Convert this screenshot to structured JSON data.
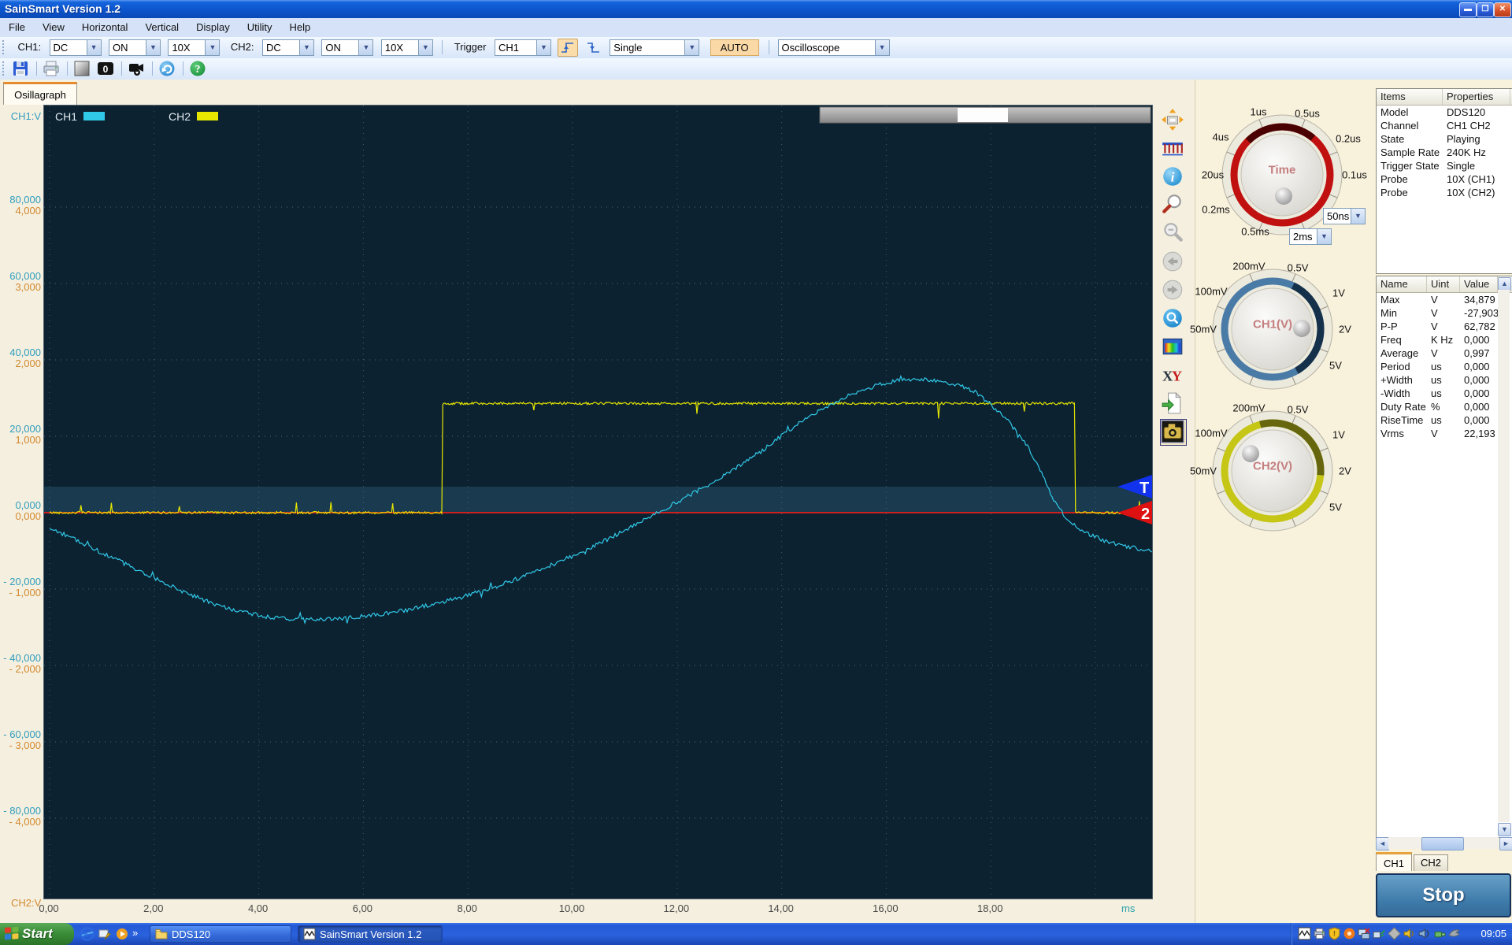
{
  "window": {
    "title": "SainSmart  Version 1.2",
    "minimize": "minimize",
    "maximize": "maximize",
    "close": "close"
  },
  "menu": {
    "items": [
      "File",
      "View",
      "Horizontal",
      "Vertical",
      "Display",
      "Utility",
      "Help"
    ]
  },
  "controls_bar": {
    "ch1_label": "CH1:",
    "ch1_coupling": "DC",
    "ch1_on": "ON",
    "ch1_probe": "10X",
    "ch2_label": "CH2:",
    "ch2_coupling": "DC",
    "ch2_on": "ON",
    "ch2_probe": "10X",
    "trigger_label": "Trigger",
    "trigger_source": "CH1",
    "trigger_mode": "Single",
    "auto_button": "AUTO",
    "instrument": "Oscilloscope"
  },
  "icon_bar": [
    "save",
    "print",
    "background",
    "counter",
    "record",
    "refresh",
    "help"
  ],
  "counter_value": "0",
  "tab_label": "Osillagraph",
  "scope": {
    "legend": [
      {
        "label": "CH1",
        "color": "#31c9e8"
      },
      {
        "label": "CH2",
        "color": "#e6e600"
      }
    ],
    "y_top": "CH1:V",
    "y_bottom": "CH2:V",
    "y_ticks": [
      {
        "value": 80000,
        "ch1": "80,000",
        "ch2": "4,000"
      },
      {
        "value": 60000,
        "ch1": "60,000",
        "ch2": "3,000"
      },
      {
        "value": 40000,
        "ch1": "40,000",
        "ch2": "2,000"
      },
      {
        "value": 20000,
        "ch1": "20,000",
        "ch2": "1,000"
      },
      {
        "value": 0,
        "ch1": "0,000",
        "ch2": "0,000"
      },
      {
        "value": -20000,
        "ch1": "- 20,000",
        "ch2": "- 1,000"
      },
      {
        "value": -40000,
        "ch1": "- 40,000",
        "ch2": "- 2,000"
      },
      {
        "value": -60000,
        "ch1": "- 60,000",
        "ch2": "- 3,000"
      },
      {
        "value": -80000,
        "ch1": "- 80,000",
        "ch2": "- 4,000"
      }
    ],
    "x_ticks": [
      {
        "t": 0,
        "label": "0,00"
      },
      {
        "t": 2,
        "label": "2,00"
      },
      {
        "t": 4,
        "label": "4,00"
      },
      {
        "t": 6,
        "label": "6,00"
      },
      {
        "t": 8,
        "label": "8,00"
      },
      {
        "t": 10,
        "label": "10,00"
      },
      {
        "t": 12,
        "label": "12,00"
      },
      {
        "t": 14,
        "label": "14,00"
      },
      {
        "t": 16,
        "label": "16,00"
      },
      {
        "t": 18,
        "label": "18,00"
      }
    ],
    "x_unit": "ms",
    "trigger_marker": "T",
    "ch2_marker": "2"
  },
  "chart_data": {
    "type": "line",
    "title": "Oscilloscope capture",
    "x_unit": "ms",
    "x_range": [
      0,
      21.1
    ],
    "x_tick_step": 2,
    "y_axis_ch1": {
      "label": "CH1:V",
      "ticks": [
        80000,
        60000,
        40000,
        20000,
        0,
        -20000,
        -40000,
        -60000,
        -80000
      ]
    },
    "y_axis_ch2": {
      "label": "CH2:V",
      "ticks": [
        4000,
        3000,
        2000,
        1000,
        0,
        -1000,
        -2000,
        -3000,
        -4000
      ]
    },
    "grid": "dotted",
    "series": [
      {
        "name": "CH1",
        "color": "#31c9e8",
        "points": [
          [
            0,
            -4500
          ],
          [
            1,
            -10500
          ],
          [
            2,
            -17000
          ],
          [
            2.8,
            -22000
          ],
          [
            3.4,
            -25000
          ],
          [
            4.2,
            -27300
          ],
          [
            5,
            -27903
          ],
          [
            5.9,
            -27300
          ],
          [
            6.6,
            -26000
          ],
          [
            7.4,
            -23800
          ],
          [
            8.2,
            -20800
          ],
          [
            9,
            -17000
          ],
          [
            9.8,
            -12500
          ],
          [
            10.6,
            -7500
          ],
          [
            11.3,
            -2500
          ],
          [
            12,
            2800
          ],
          [
            12.8,
            9000
          ],
          [
            13.6,
            16000
          ],
          [
            14.3,
            23000
          ],
          [
            15,
            28800
          ],
          [
            15.7,
            32800
          ],
          [
            16.4,
            34879
          ],
          [
            17.1,
            34100
          ],
          [
            17.7,
            31500
          ],
          [
            18.3,
            24500
          ],
          [
            18.7,
            17500
          ],
          [
            19.0,
            9500
          ],
          [
            19.2,
            3500
          ],
          [
            19.45,
            -1500
          ],
          [
            19.8,
            -5000
          ],
          [
            20.2,
            -7400
          ],
          [
            20.6,
            -8900
          ],
          [
            21.08,
            -9900
          ]
        ]
      },
      {
        "name": "CH2",
        "color": "#e6e600",
        "shape": "square",
        "low_level": 0,
        "high_level": 28600,
        "high_level_ch2_units": 1430,
        "rise_at": 7.5,
        "fall_at": 19.6
      }
    ],
    "trigger_level": 6800,
    "zero_line": 0,
    "legend_position": "top-left"
  },
  "side_tools": [
    "pan",
    "ruler",
    "info",
    "zoom-in",
    "zoom-out",
    "back",
    "forward",
    "search",
    "palette",
    "xy",
    "export",
    "camera"
  ],
  "knobs": {
    "time": {
      "title": "Time",
      "labels": [
        "1us",
        "0.5us",
        "4us",
        "0.2us",
        "20us",
        "0.1us",
        "0.2ms",
        "0.5ms"
      ],
      "select_small": "50ns",
      "select_large": "2ms"
    },
    "ch1": {
      "title": "CH1(V)",
      "labels": [
        "200mV",
        "0.5V",
        "100mV",
        "1V",
        "50mV",
        "2V",
        "5V"
      ]
    },
    "ch2": {
      "title": "CH2(V)",
      "labels": [
        "200mV",
        "0.5V",
        "100mV",
        "1V",
        "50mV",
        "2V",
        "5V"
      ]
    }
  },
  "properties": {
    "headers": [
      "Items",
      "Properties"
    ],
    "rows": [
      [
        "Model",
        "DDS120"
      ],
      [
        "Channel",
        "CH1 CH2"
      ],
      [
        "State",
        "Playing"
      ],
      [
        "Sample Rate",
        "240K Hz"
      ],
      [
        "Trigger State",
        "Single"
      ],
      [
        "Probe",
        "10X (CH1)"
      ],
      [
        "Probe",
        "10X (CH2)"
      ]
    ]
  },
  "measures": {
    "headers": [
      "Name",
      "Uint",
      "Value"
    ],
    "rows": [
      [
        "Max",
        "V",
        "34,879"
      ],
      [
        "Min",
        "V",
        "-27,903"
      ],
      [
        "P-P",
        "V",
        "62,782"
      ],
      [
        "Freq",
        "K Hz",
        "0,000"
      ],
      [
        "Average",
        "V",
        "0,997"
      ],
      [
        "Period",
        "us",
        "0,000"
      ],
      [
        "+Width",
        "us",
        "0,000"
      ],
      [
        "-Width",
        "us",
        "0,000"
      ],
      [
        "Duty Rate",
        "%",
        "0,000"
      ],
      [
        "RiseTime",
        "us",
        "0,000"
      ],
      [
        "Vrms",
        "V",
        "22,193"
      ]
    ]
  },
  "bottom_tabs": [
    "CH1",
    "CH2"
  ],
  "stop_label": "Stop",
  "taskbar": {
    "start": "Start",
    "overflow": "»",
    "quick_launch": [
      "internet-explorer",
      "show-desktop",
      "media-player"
    ],
    "tasks": [
      "DDS120",
      "SainSmart  Version 1.2"
    ],
    "tray": [
      "scope-app",
      "print-spooler",
      "security-shield",
      "firewall",
      "network-offline",
      "wireless",
      "status-diamond",
      "volume",
      "audio-device",
      "usb-device",
      "antivirus"
    ],
    "clock": "09:05"
  }
}
